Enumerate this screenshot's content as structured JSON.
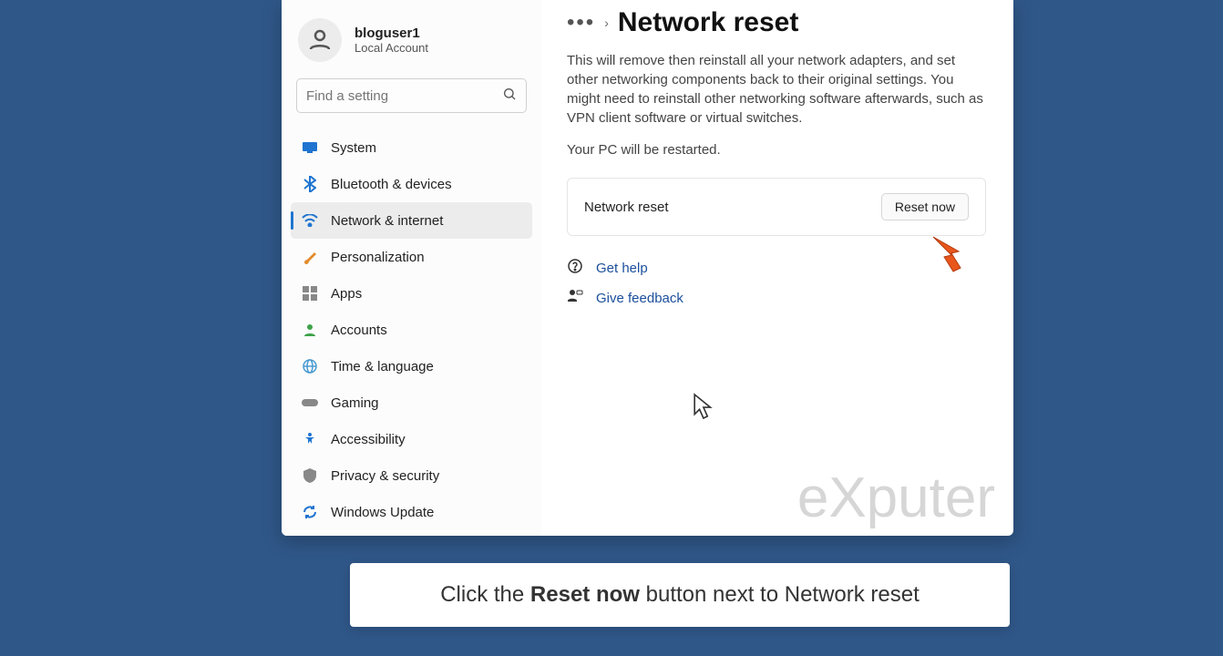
{
  "user": {
    "name": "bloguser1",
    "subtitle": "Local Account"
  },
  "search": {
    "placeholder": "Find a setting"
  },
  "nav": [
    {
      "id": "system",
      "label": "System",
      "color": "#1f74d0"
    },
    {
      "id": "bluetooth",
      "label": "Bluetooth & devices",
      "color": "#1f74d0"
    },
    {
      "id": "network",
      "label": "Network & internet",
      "color": "#1f74d0",
      "selected": true
    },
    {
      "id": "personalization",
      "label": "Personalization",
      "color": "#e38b2d"
    },
    {
      "id": "apps",
      "label": "Apps",
      "color": "#888"
    },
    {
      "id": "accounts",
      "label": "Accounts",
      "color": "#3fa24a"
    },
    {
      "id": "time",
      "label": "Time & language",
      "color": "#4a9bd1"
    },
    {
      "id": "gaming",
      "label": "Gaming",
      "color": "#888"
    },
    {
      "id": "accessibility",
      "label": "Accessibility",
      "color": "#1f74d0"
    },
    {
      "id": "privacy",
      "label": "Privacy & security",
      "color": "#888"
    },
    {
      "id": "update",
      "label": "Windows Update",
      "color": "#1f74d0"
    }
  ],
  "page": {
    "title": "Network reset",
    "desc": "This will remove then reinstall all your network adapters, and set other networking components back to their original settings. You might need to reinstall other networking software afterwards, such as VPN client software or virtual switches.",
    "subdesc": "Your PC will be restarted.",
    "card_label": "Network reset",
    "reset_btn": "Reset now",
    "help": "Get help",
    "feedback": "Give feedback"
  },
  "watermark": "eXputer",
  "caption": {
    "pre": "Click the ",
    "bold": "Reset now",
    "post": " button next to Network reset"
  }
}
